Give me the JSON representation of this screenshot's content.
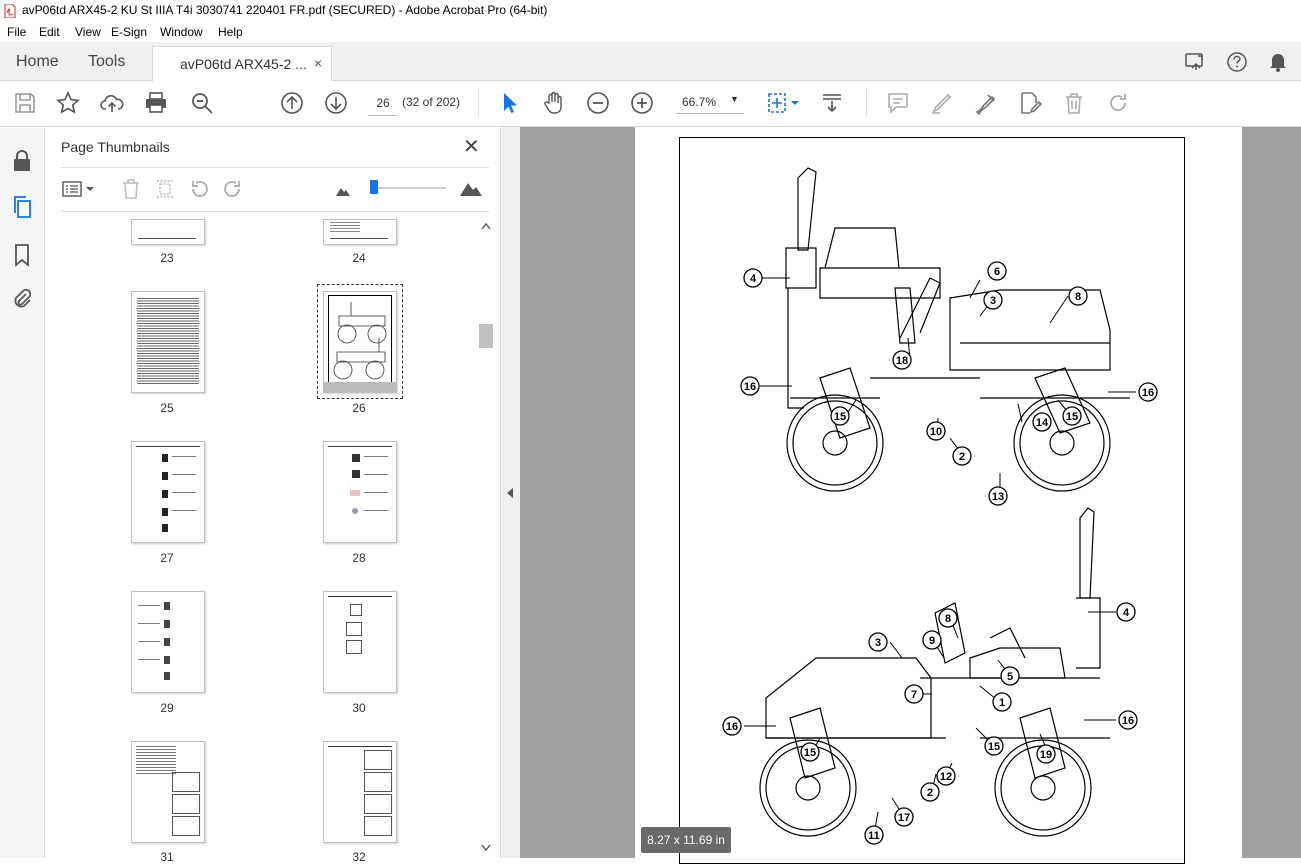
{
  "window": {
    "title": "avP06td ARX45-2 KU St IIIA T4i 3030741 220401 FR.pdf (SECURED) - Adobe Acrobat Pro (64-bit)"
  },
  "menu": [
    "File",
    "Edit",
    "View",
    "E-Sign",
    "Window",
    "Help"
  ],
  "tabs": {
    "home": "Home",
    "tools": "Tools",
    "document": "avP06td ARX45-2 ...",
    "close": "×"
  },
  "toolbar": {
    "page_current": "26",
    "page_count": "(32 of 202)",
    "zoom": "66.7%"
  },
  "thumbnails_panel": {
    "title": "Page Thumbnails",
    "pages": [
      "23",
      "24",
      "25",
      "26",
      "27",
      "28",
      "29",
      "30",
      "31",
      "32"
    ],
    "selected": "26"
  },
  "document": {
    "page_size": "8.27 x 11.69 in",
    "callouts_top": [
      "4",
      "6",
      "3",
      "8",
      "18",
      "16",
      "16",
      "15",
      "14",
      "15",
      "10",
      "2",
      "13"
    ],
    "callouts_bottom": [
      "4",
      "8",
      "9",
      "3",
      "5",
      "7",
      "1",
      "16",
      "16",
      "15",
      "19",
      "15",
      "12",
      "2",
      "17",
      "11"
    ]
  }
}
